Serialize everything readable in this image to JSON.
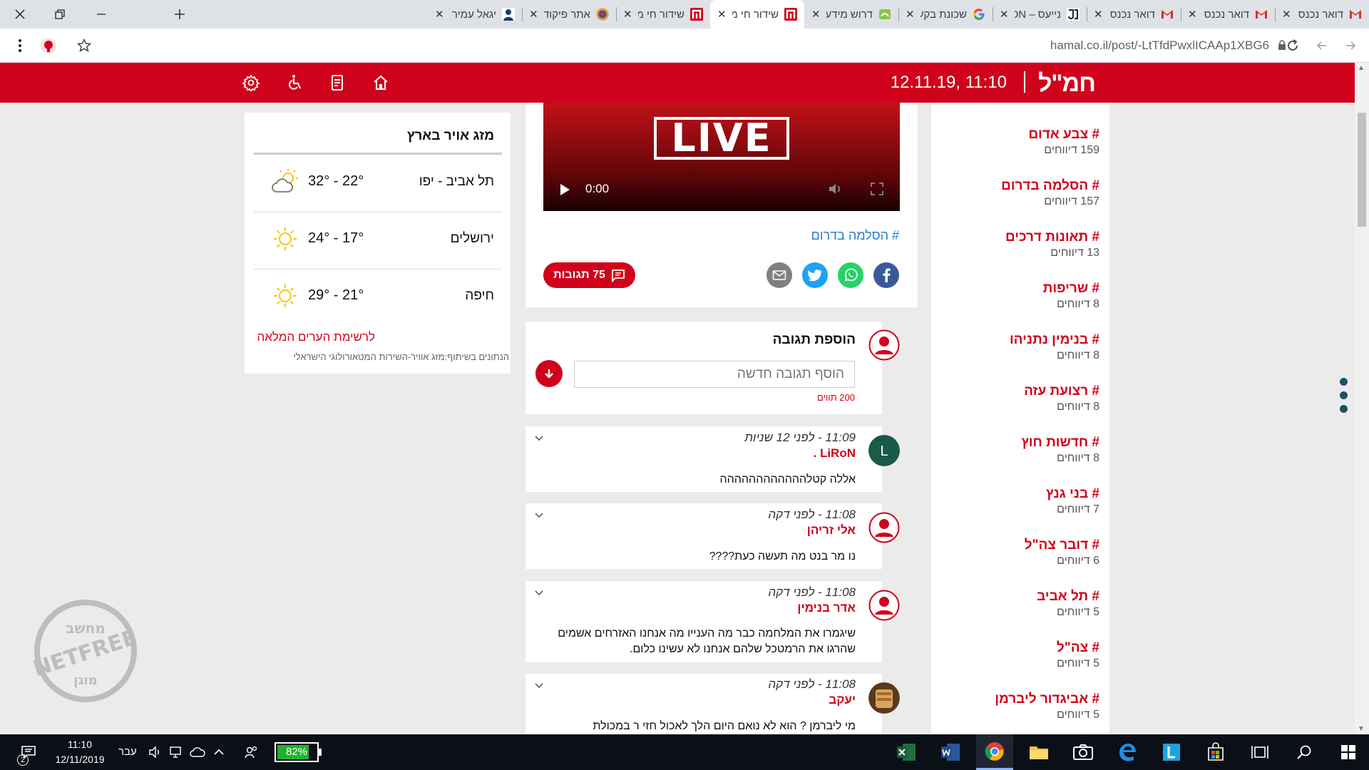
{
  "browser": {
    "tabs": [
      {
        "title": "דואר נכנס",
        "fav": "gmail",
        "active": false
      },
      {
        "title": "דואר נכנס -",
        "fav": "gmail",
        "active": false
      },
      {
        "title": "דואר נכנס -",
        "fav": "gmail",
        "active": false
      },
      {
        "title": "נייעס – JDN",
        "fav": "jdn",
        "active": false
      },
      {
        "title": "שכונת בקעה",
        "fav": "google",
        "active": false
      },
      {
        "title": "דרוש מידע -",
        "fav": "green",
        "active": false
      },
      {
        "title": "שידור חי מה",
        "fav": "hamal",
        "active": true
      },
      {
        "title": "שידור חי מה",
        "fav": "hamal",
        "active": false
      },
      {
        "title": "אתר פיקוד ה",
        "fav": "oref",
        "active": false
      },
      {
        "title": "יגאל עמיר –",
        "fav": "person",
        "active": false
      }
    ],
    "url": "hamal.co.il/post/-LtTfdPwxlICAAp1XBG6"
  },
  "header": {
    "logo": "חמ\"ל",
    "datetime": "12.11.19, 11:10"
  },
  "tags": [
    {
      "name": "# צבע אדום",
      "count": "159 דיווחים"
    },
    {
      "name": "# הסלמה בדרום",
      "count": "157 דיווחים"
    },
    {
      "name": "# תאונות דרכים",
      "count": "13 דיווחים"
    },
    {
      "name": "# שריפות",
      "count": "8 דיווחים"
    },
    {
      "name": "# בנימין נתניהו",
      "count": "8 דיווחים"
    },
    {
      "name": "# רצועת עזה",
      "count": "8 דיווחים"
    },
    {
      "name": "# חדשות חוץ",
      "count": "8 דיווחים"
    },
    {
      "name": "# בני גנץ",
      "count": "7 דיווחים"
    },
    {
      "name": "# דובר צה\"ל",
      "count": "6 דיווחים"
    },
    {
      "name": "# תל אביב",
      "count": "5 דיווחים"
    },
    {
      "name": "# צה\"ל",
      "count": "5 דיווחים"
    },
    {
      "name": "# אביגדור ליברמן",
      "count": "5 דיווחים"
    }
  ],
  "video": {
    "live_label": "LIVE",
    "time": "0:00"
  },
  "article": {
    "tag": "# הסלמה בדרום",
    "comments_label": "75 תגובות"
  },
  "add_comment": {
    "title": "הוספת תגובה",
    "placeholder": "הוסף תגובה חדשה",
    "char_limit": "200 תווים"
  },
  "comments": [
    {
      "meta": "11:09 - לפני 12 שניות",
      "author": "LiRoN .",
      "avatar": "L",
      "text": "אללה קטלהההההההההההה"
    },
    {
      "meta": "11:08 - לפני דקה",
      "author": "אלי זריהן",
      "avatar": "user",
      "text": "נו מר בנט מה תעשה כעת????"
    },
    {
      "meta": "11:08 - לפני דקה",
      "author": "אדר בנימין",
      "avatar": "user",
      "text": "שיגמרו את המלחמה כבר מה הענייו מה אנחנו האזרחים אשמים שהרגו את הרמטכל שלהם אנחנו לא עשינו כלום."
    },
    {
      "meta": "11:08 - לפני דקה",
      "author": "יעקב",
      "avatar": "photo",
      "text": "מי ליברמן ? הוא לא נואם היום הלך לאכול חזי ר במכולת"
    }
  ],
  "weather": {
    "title": "מזג אויר בארץ",
    "cities": [
      {
        "name": "תל אביב - יפו",
        "temp": "32° - 22°",
        "icon": "partly-cloudy"
      },
      {
        "name": "ירושלים",
        "temp": "24° - 17°",
        "icon": "sunny"
      },
      {
        "name": "חיפה",
        "temp": "29° - 21°",
        "icon": "sunny"
      }
    ],
    "full_list_link": "לרשימת הערים המלאה",
    "credit": "הנתונים בשיתוף:מזג אוויר-השירות המטאורולוגי הישראלי"
  },
  "watermark": {
    "text_top": "מחשב",
    "text_mid": "NETFREE",
    "text_bot": "מוגן"
  },
  "taskbar": {
    "notifications": "2",
    "time": "11:10",
    "date": "12/11/2019",
    "language": "עבר",
    "battery": "82%",
    "battery_level": 0.82
  },
  "colors": {
    "brand": "#d0021b",
    "link": "#2a7ad5"
  }
}
